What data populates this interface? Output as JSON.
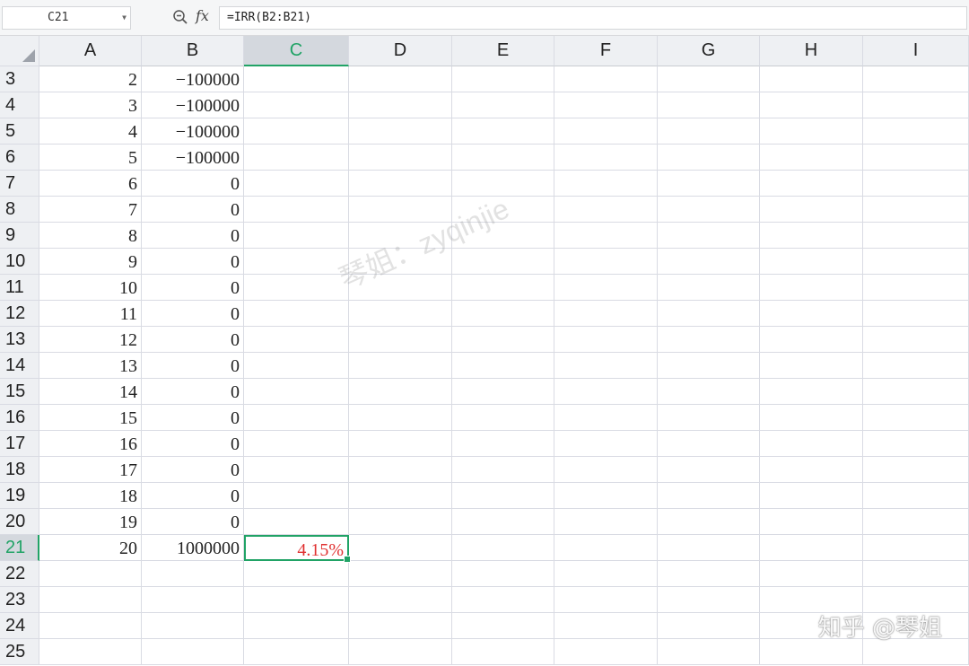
{
  "formula_bar": {
    "cell_ref": "C21",
    "fx": "fx",
    "formula": "=IRR(B2:B21)"
  },
  "columns": [
    "A",
    "B",
    "C",
    "D",
    "E",
    "F",
    "G",
    "H",
    "I"
  ],
  "rows": [
    {
      "num": "3",
      "a": "2",
      "b": "−100000",
      "c": ""
    },
    {
      "num": "4",
      "a": "3",
      "b": "−100000",
      "c": ""
    },
    {
      "num": "5",
      "a": "4",
      "b": "−100000",
      "c": ""
    },
    {
      "num": "6",
      "a": "5",
      "b": "−100000",
      "c": ""
    },
    {
      "num": "7",
      "a": "6",
      "b": "0",
      "c": ""
    },
    {
      "num": "8",
      "a": "7",
      "b": "0",
      "c": ""
    },
    {
      "num": "9",
      "a": "8",
      "b": "0",
      "c": ""
    },
    {
      "num": "10",
      "a": "9",
      "b": "0",
      "c": ""
    },
    {
      "num": "11",
      "a": "10",
      "b": "0",
      "c": ""
    },
    {
      "num": "12",
      "a": "11",
      "b": "0",
      "c": ""
    },
    {
      "num": "13",
      "a": "12",
      "b": "0",
      "c": ""
    },
    {
      "num": "14",
      "a": "13",
      "b": "0",
      "c": ""
    },
    {
      "num": "15",
      "a": "14",
      "b": "0",
      "c": ""
    },
    {
      "num": "16",
      "a": "15",
      "b": "0",
      "c": ""
    },
    {
      "num": "17",
      "a": "16",
      "b": "0",
      "c": ""
    },
    {
      "num": "18",
      "a": "17",
      "b": "0",
      "c": ""
    },
    {
      "num": "19",
      "a": "18",
      "b": "0",
      "c": ""
    },
    {
      "num": "20",
      "a": "19",
      "b": "0",
      "c": ""
    },
    {
      "num": "21",
      "a": "20",
      "b": "1000000",
      "c": "4.15%"
    },
    {
      "num": "22",
      "a": "",
      "b": "",
      "c": ""
    },
    {
      "num": "23",
      "a": "",
      "b": "",
      "c": ""
    },
    {
      "num": "24",
      "a": "",
      "b": "",
      "c": ""
    },
    {
      "num": "25",
      "a": "",
      "b": "",
      "c": ""
    }
  ],
  "active_column": "C",
  "active_row": "21",
  "watermark": "琴姐：zyqinjie",
  "brand": "知乎 @琴姐",
  "colors": {
    "accent": "#21a366",
    "result_text": "#e03030"
  }
}
